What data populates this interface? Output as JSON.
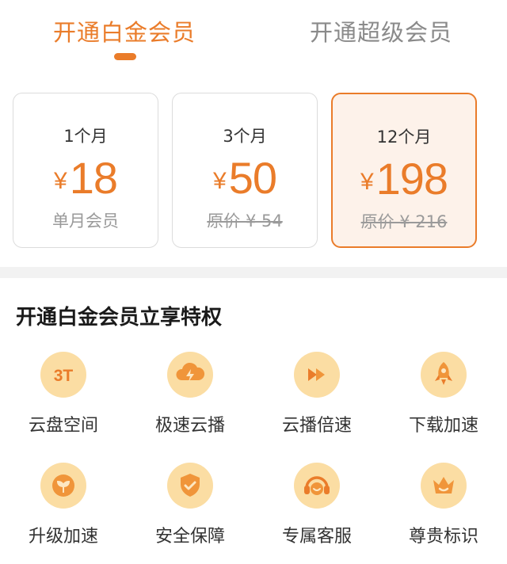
{
  "tabs": {
    "platinum": "开通白金会员",
    "super": "开通超级会员"
  },
  "plans": [
    {
      "duration": "1个月",
      "currency": "¥",
      "price": "18",
      "note": "单月会员"
    },
    {
      "duration": "3个月",
      "currency": "¥",
      "price": "50",
      "note": "原价 ¥ 54"
    },
    {
      "duration": "12个月",
      "currency": "¥",
      "price": "198",
      "note": "原价 ¥ 216"
    }
  ],
  "benefits": {
    "title": "开通白金会员立享特权",
    "items": [
      {
        "label": "云盘空间",
        "icon": "3t-icon",
        "icon_text": "3T"
      },
      {
        "label": "极速云播",
        "icon": "cloud-bolt-icon"
      },
      {
        "label": "云播倍速",
        "icon": "fast-forward-icon"
      },
      {
        "label": "下载加速",
        "icon": "rocket-icon"
      },
      {
        "label": "升级加速",
        "icon": "sprout-icon"
      },
      {
        "label": "安全保障",
        "icon": "shield-check-icon"
      },
      {
        "label": "专属客服",
        "icon": "headset-icon"
      },
      {
        "label": "尊贵标识",
        "icon": "crown-icon"
      }
    ]
  },
  "colors": {
    "accent": "#ea7c2a",
    "icon_bg": "#fbdda3",
    "selected_bg": "#fdf2ea"
  }
}
